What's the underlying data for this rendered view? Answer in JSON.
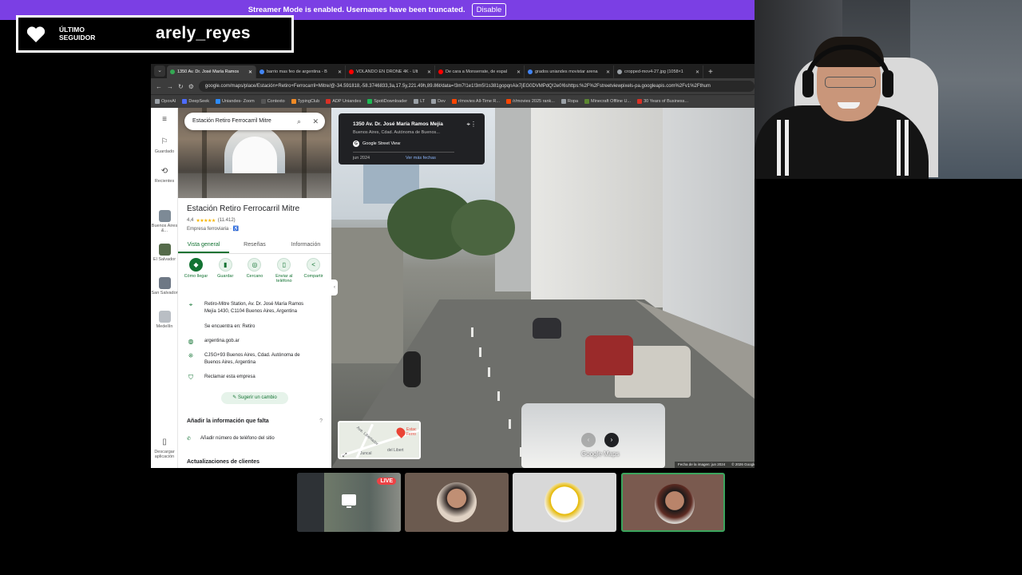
{
  "streamer_bar": {
    "message": "Streamer Mode is enabled. Usernames have been truncated.",
    "disable_label": "Disable"
  },
  "follower_alert": {
    "label_line1": "ÚLTIMO",
    "label_line2": "SEGUIDOR",
    "username": "arely_reyes"
  },
  "browser": {
    "tabs": [
      {
        "title": "1350 Av. Dr. José María Ramos",
        "favicon_color": "#34a853",
        "active": true
      },
      {
        "title": "barrio mas feo de argentina - B",
        "favicon_color": "#4285f4",
        "active": false
      },
      {
        "title": "VOLANDO EN DRONE 4K - Ult",
        "favicon_color": "#ff0000",
        "active": false
      },
      {
        "title": "De cara a Monserrate, de espal",
        "favicon_color": "#ff0000",
        "active": false
      },
      {
        "title": "grados uniandes movistar arena",
        "favicon_color": "#4285f4",
        "active": false
      },
      {
        "title": "cropped-mov4-27.jpg (1058×1",
        "favicon_color": "#9aa0a6",
        "active": false
      }
    ],
    "url": "google.com/maps/place/Estación+Retiro+Ferrocarril+Mitre/@-34.591818,-58.3746833,3a,17.5y,221.49h,89.86t/data=!3m7!1e1!3m5!1s381gopqnAix7jEG0DVMPdQ!2e0!6shttps:%2F%2Fstreetviewpixels-pa.googleapis.com%2Fv1%2Fthum",
    "bookmarks": [
      {
        "label": "OpoxAI",
        "color": "#9aa0a6"
      },
      {
        "label": "DeepSeek",
        "color": "#4d6bfe"
      },
      {
        "label": "Uniandes- Zoom",
        "color": "#2d8cff"
      },
      {
        "label": "Contexto",
        "color": "#555555"
      },
      {
        "label": "TypingClub",
        "color": "#f28b25"
      },
      {
        "label": "ADP Uniandes",
        "color": "#d93025"
      },
      {
        "label": "SpotiDownloader",
        "color": "#1db954"
      },
      {
        "label": "LT",
        "color": "#9aa0a6"
      },
      {
        "label": "Dev",
        "color": "#9aa0a6"
      },
      {
        "label": "r/movies All-Time R...",
        "color": "#ff4500"
      },
      {
        "label": "/r/movies 2025 rank...",
        "color": "#ff4500"
      },
      {
        "label": "Ropa",
        "color": "#9aa0a6"
      },
      {
        "label": "Minecraft Offline U...",
        "color": "#5b8731"
      },
      {
        "label": "30 Years of Business...",
        "color": "#d93025"
      }
    ]
  },
  "maps": {
    "rail": {
      "saved": "Guardado",
      "recent": "Recientes",
      "places": [
        "Buenos Aires &...",
        "El Salvador",
        "San Salvador",
        "Medellín"
      ],
      "download": "Descargar aplicación"
    },
    "search_value": "Estación Retiro Ferrocarril Mitre",
    "place": {
      "title": "Estación Retiro Ferrocarril Mitre",
      "rating": "4,4",
      "stars": "★★★★★",
      "reviews": "(11.412)",
      "type": "Empresa ferroviaria · ♿"
    },
    "tabs": [
      "Vista general",
      "Reseñas",
      "Información"
    ],
    "actions": [
      {
        "label": "Cómo llegar",
        "glyph": "◆"
      },
      {
        "label": "Guardar",
        "glyph": "▮"
      },
      {
        "label": "Cercano",
        "glyph": "◎"
      },
      {
        "label": "Enviar al teléfono",
        "glyph": "▯"
      },
      {
        "label": "Compartir",
        "glyph": "<"
      }
    ],
    "info": {
      "address": "Retiro-Mitre Station, Av. Dr. José María Ramos Mejía 1430, C1104 Buenos Aires, Argentina",
      "located_in": "Se encuentra en: Retiro",
      "website": "argentina.gob.ar",
      "plus_code": "CJSG+93 Buenos Aires, Cdad. Autónoma de Buenos Aires, Argentina",
      "claim": "Reclamar esta empresa"
    },
    "suggest_edit": "Sugerir un cambio",
    "add_info_title": "Añadir la información que falta",
    "add_phone": "Añadir número de teléfono del sitio",
    "updates_title": "Actualizaciones de clientes",
    "streetview_card": {
      "address": "1350 Av. Dr. José María Ramos Mejía",
      "subtitle": "Buenos Aires, Cdad. Autónoma de Buenos...",
      "source": "Google Street View",
      "date": "jun 2024",
      "more_dates": "Ver más fechas"
    },
    "minimap_labels": [
      "Estac",
      "Ferro",
      "Ave. Libertador",
      "Juncal",
      "del Libert"
    ],
    "logo": "Google Maps",
    "footer": [
      "Fecha de la imagen: jun 2024",
      "© 2026 Google",
      "Colombia",
      "Términos",
      "Privacidad",
      "Notificar un problema"
    ]
  },
  "call_tiles": [
    {
      "live_label": "LIVE",
      "bg": "#3b3f43"
    },
    {
      "bg": "#6b5a4f"
    },
    {
      "bg": "#d8d8d8"
    },
    {
      "bg": "#7a5a4f",
      "speaking": true
    }
  ]
}
